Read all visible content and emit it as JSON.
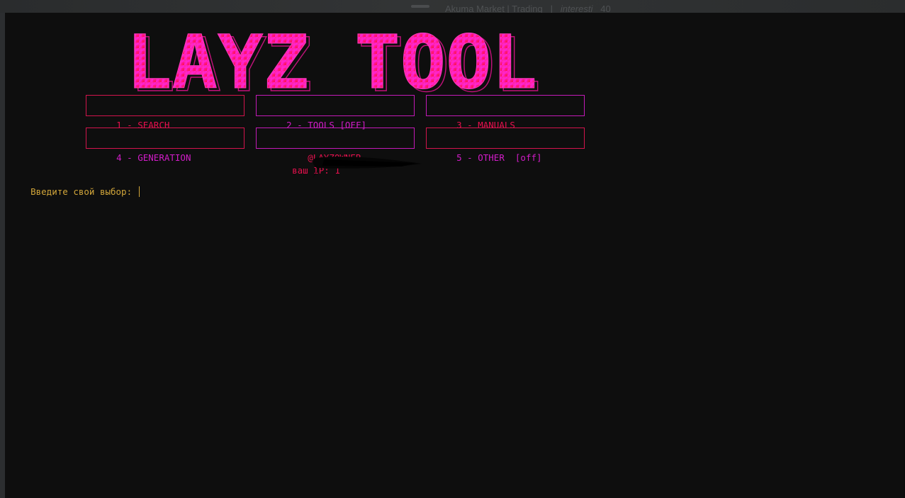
{
  "background_window": {
    "title": "Akuma Market | Trading",
    "separator": "|",
    "extra": "interesti",
    "count": "40"
  },
  "terminal": {
    "logo_text": "LAYZ TOOL",
    "menu": [
      {
        "label": "1 - SEARCH",
        "color": "#e8104e"
      },
      {
        "label": "2 - TOOLS [OFF]",
        "color": "#d21cc8"
      },
      {
        "label": "3 - MANUALS",
        "color": "#e8104e"
      },
      {
        "label": "4 - GENERATION",
        "color": "#d21cc8"
      },
      {
        "label": "    @LAYZOWNER",
        "color": "#e8104e"
      },
      {
        "label": "5 - OTHER  [off]",
        "color": "#d21cc8"
      }
    ],
    "ip_label": "ваш IP: 1",
    "prompt": "Введите свой выбор: "
  },
  "colors": {
    "background": "#0e0e0e",
    "accent_red": "#e8104e",
    "accent_magenta": "#d21cc8",
    "prompt": "#d2a63a"
  }
}
